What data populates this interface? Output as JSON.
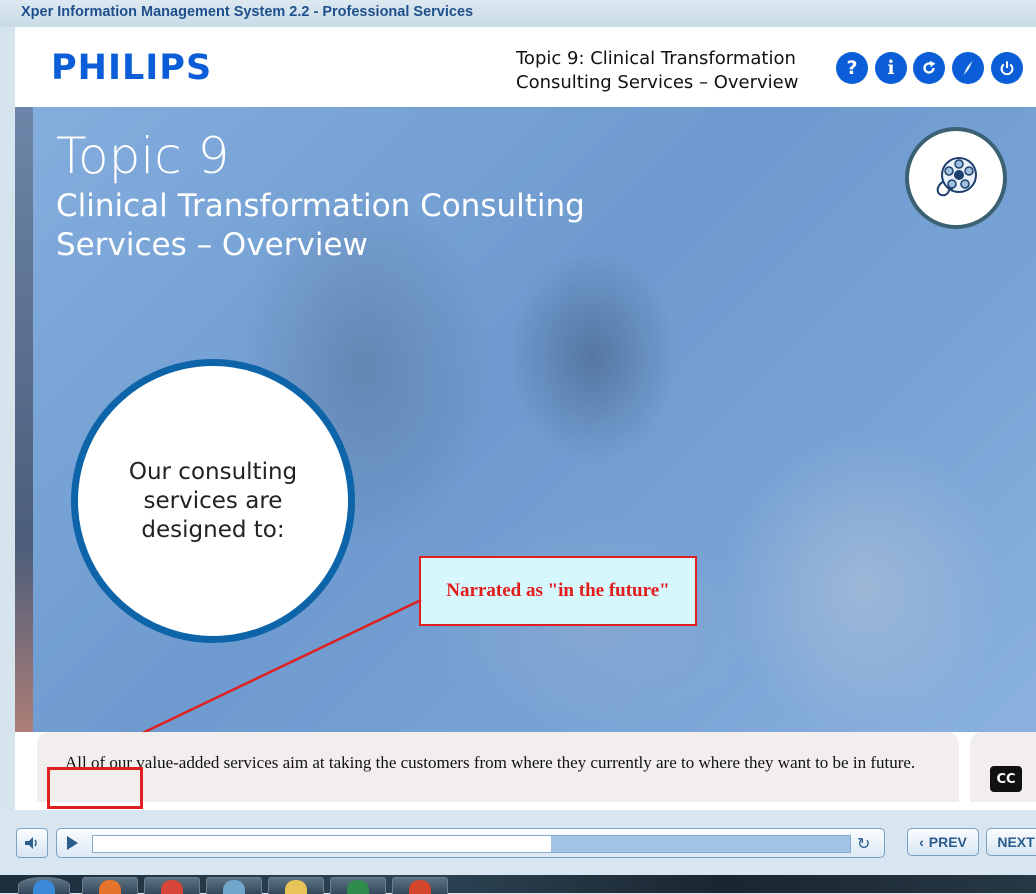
{
  "window": {
    "title": "Xper Information Management System 2.2 - Professional Services"
  },
  "header": {
    "logo": "PHILIPS",
    "topic_line1": "Topic 9: Clinical Transformation",
    "topic_line2": "Consulting Services – Overview",
    "buttons": [
      {
        "name": "help",
        "glyph": "?"
      },
      {
        "name": "info",
        "glyph": "i"
      },
      {
        "name": "refresh",
        "glyph": "refresh-icon"
      },
      {
        "name": "compass",
        "glyph": "compass-icon"
      },
      {
        "name": "power",
        "glyph": "power-icon"
      }
    ]
  },
  "slide": {
    "heading": "Topic 9",
    "subheading": "Clinical Transformation Consulting Services – Overview",
    "circle_text": "Our consulting services are designed to:",
    "media_icon": "film-reel-icon"
  },
  "annotation": {
    "text": "Narrated as \"in the future\"",
    "color": "#e21b1b"
  },
  "caption": {
    "text": "All of our value-added services aim at taking the customers from where they currently are to where they want to be in future.",
    "cc_label": "CC"
  },
  "player": {
    "progress": 0.605
  },
  "nav": {
    "prev_label": "PREV",
    "next_label": "NEXT"
  },
  "taskbar": {
    "apps": [
      "ie-icon",
      "firefox-icon",
      "chrome-icon",
      "explorer-icon",
      "folder-icon",
      "excel-icon",
      "powerpoint-icon"
    ]
  },
  "colors": {
    "brand": "#0b5ed7",
    "circle_border": "#0d64a8",
    "annotation_border": "#e02020"
  }
}
